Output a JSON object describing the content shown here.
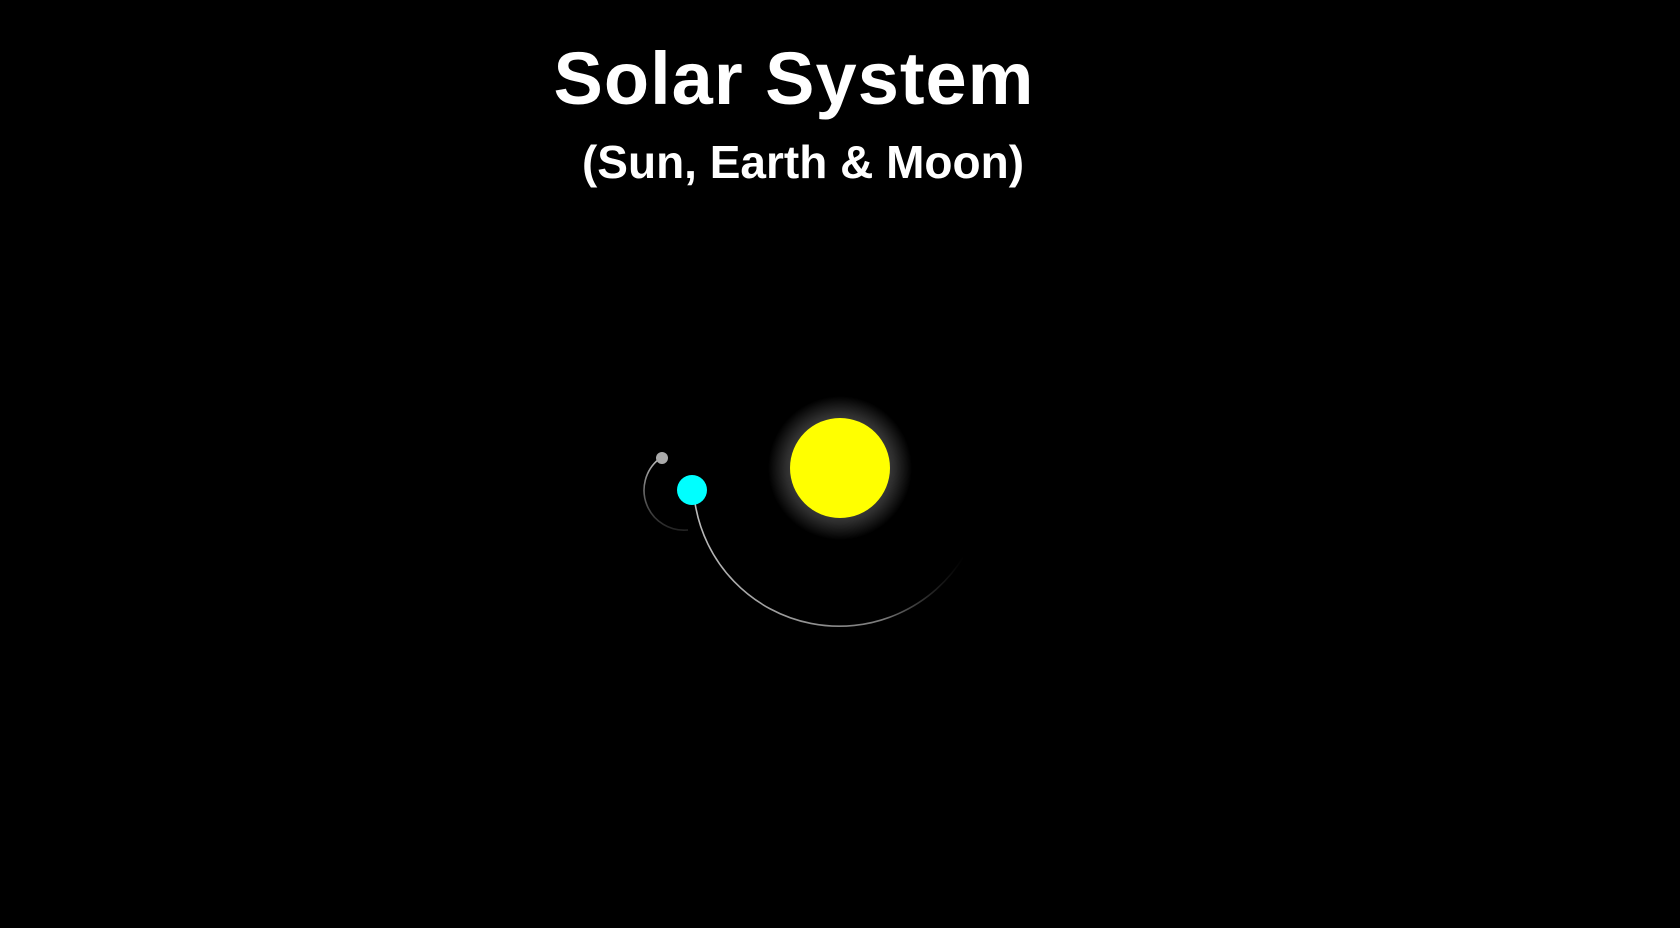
{
  "header": {
    "title": "Solar System",
    "subtitle": "(Sun, Earth & Moon)"
  },
  "scene": {
    "bodies": [
      {
        "name": "sun",
        "color": "#ffff00",
        "glow_color": "#ffffff"
      },
      {
        "name": "earth",
        "color": "#00ffff"
      },
      {
        "name": "moon",
        "color": "#aaaaaa"
      }
    ],
    "orbit_trail_color": "#bbbbbb",
    "background_color": "#000000"
  }
}
